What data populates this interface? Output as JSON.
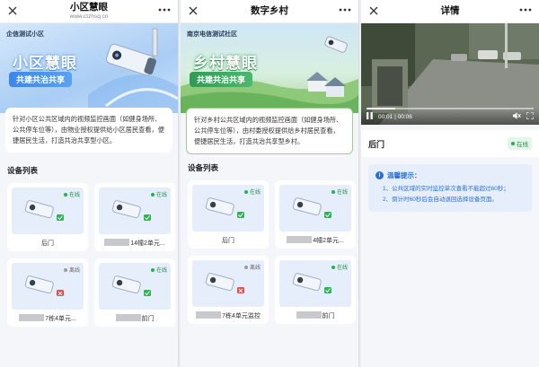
{
  "screens": [
    {
      "nav": {
        "title": "小区慧眼",
        "subtitle": "www.ctzhsq.cn"
      },
      "banner": {
        "community": "企信测试小区",
        "headline": "小区慧眼",
        "slogan": "共建共治共享"
      },
      "description": "针对小区公共区域内的视频监控画面（如健身场所、公共停车位等），由物业授权提供给小区居民查看，便捷居民生活，打造共治共享型小区。",
      "section_title": "设备列表",
      "devices": [
        {
          "name": "后门",
          "status": "在线",
          "masked": false
        },
        {
          "name": "14幢2单元...",
          "status": "在线",
          "masked": true
        },
        {
          "name": "7栋4单元...",
          "status": "离线",
          "masked": true
        },
        {
          "name": "前门",
          "status": "在线",
          "masked": true
        }
      ]
    },
    {
      "nav": {
        "title": "数字乡村"
      },
      "banner": {
        "community": "南京电信测试社区",
        "headline": "乡村慧眼",
        "slogan": "共建共治共享"
      },
      "description": "针对乡村公共区域内的视频监控画面（如健身场所、公共停车位等），由村委授权提供给乡村居民查看，便捷居民生活，打造共治共享型乡村。",
      "section_title": "设备列表",
      "devices": [
        {
          "name": "后门",
          "status": "在线",
          "masked": false
        },
        {
          "name": "4幢2单元...",
          "status": "在线",
          "masked": true
        },
        {
          "name": "7栋4单元监控",
          "status": "离线",
          "masked": true
        },
        {
          "name": "前门",
          "status": "在线",
          "masked": true
        }
      ]
    },
    {
      "nav": {
        "title": "详情"
      },
      "video": {
        "time_current": "00:01",
        "time_total": "00:06",
        "progress": 0.17
      },
      "device_name": "后门",
      "device_status": "在线",
      "tips": {
        "title": "温馨提示：",
        "items": [
          "1、公共区域的实时监控单次查看不能超过60秒；",
          "2、倒计时60秒后会自动退回选择设备页面。"
        ]
      }
    }
  ],
  "colors": {
    "online": "#22b14c",
    "offline": "#9a9a9a",
    "accent_blue": "#2b6fd6",
    "accent_green": "#2f9b55"
  }
}
